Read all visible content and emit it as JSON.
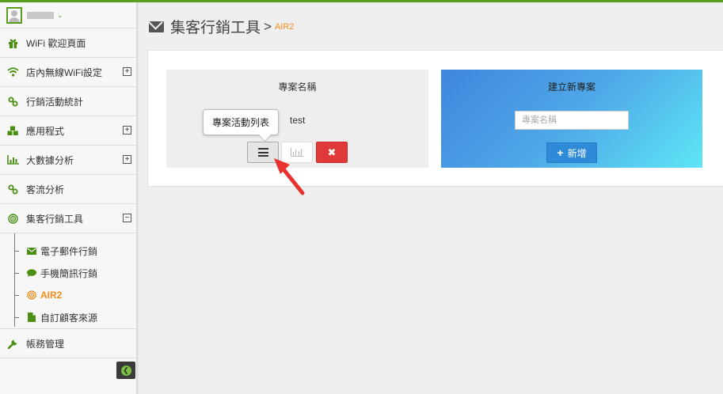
{
  "sidebar": {
    "items": [
      {
        "label": "WiFi 歡迎頁面",
        "icon": "gift-icon"
      },
      {
        "label": "店內無線WiFi設定",
        "icon": "wifi-icon",
        "toggle": "⊞"
      },
      {
        "label": "行銷活動統計",
        "icon": "link-icon"
      },
      {
        "label": "應用程式",
        "icon": "cubes-icon",
        "toggle": "⊞"
      },
      {
        "label": "大數據分析",
        "icon": "bar-chart-icon",
        "toggle": "⊞"
      },
      {
        "label": "客流分析",
        "icon": "link-icon"
      },
      {
        "label": "集客行銷工具",
        "icon": "target-icon",
        "toggle": "⊟"
      },
      {
        "label": "帳務管理",
        "icon": "wrench-icon"
      }
    ],
    "toggles": {
      "expand": "+",
      "collapse": "−"
    },
    "submenu": [
      {
        "label": "電子郵件行銷",
        "icon": "envelope-icon"
      },
      {
        "label": "手機簡訊行銷",
        "icon": "comment-icon"
      },
      {
        "label": "AIR2",
        "icon": "bullseye-icon",
        "active": true
      },
      {
        "label": "自訂顧客來源",
        "icon": "file-icon"
      }
    ],
    "collapse_icon": "arrow-left-icon",
    "collapse_glyph": "❮"
  },
  "header": {
    "title": "集客行銷工具",
    "separator": ">",
    "crumb": "AIR2"
  },
  "project": {
    "column_title": "專案名稱",
    "name": "test",
    "tooltip": "專案活動列表",
    "delete_glyph": "✖"
  },
  "new_project": {
    "title": "建立新專案",
    "placeholder": "專案名稱",
    "add_plus": "+",
    "add_label": "新增"
  },
  "colors": {
    "brand_green": "#5a9e1f",
    "active_orange": "#f28c1b",
    "delete_red": "#e0393a",
    "add_blue": "#2f8ad8"
  }
}
